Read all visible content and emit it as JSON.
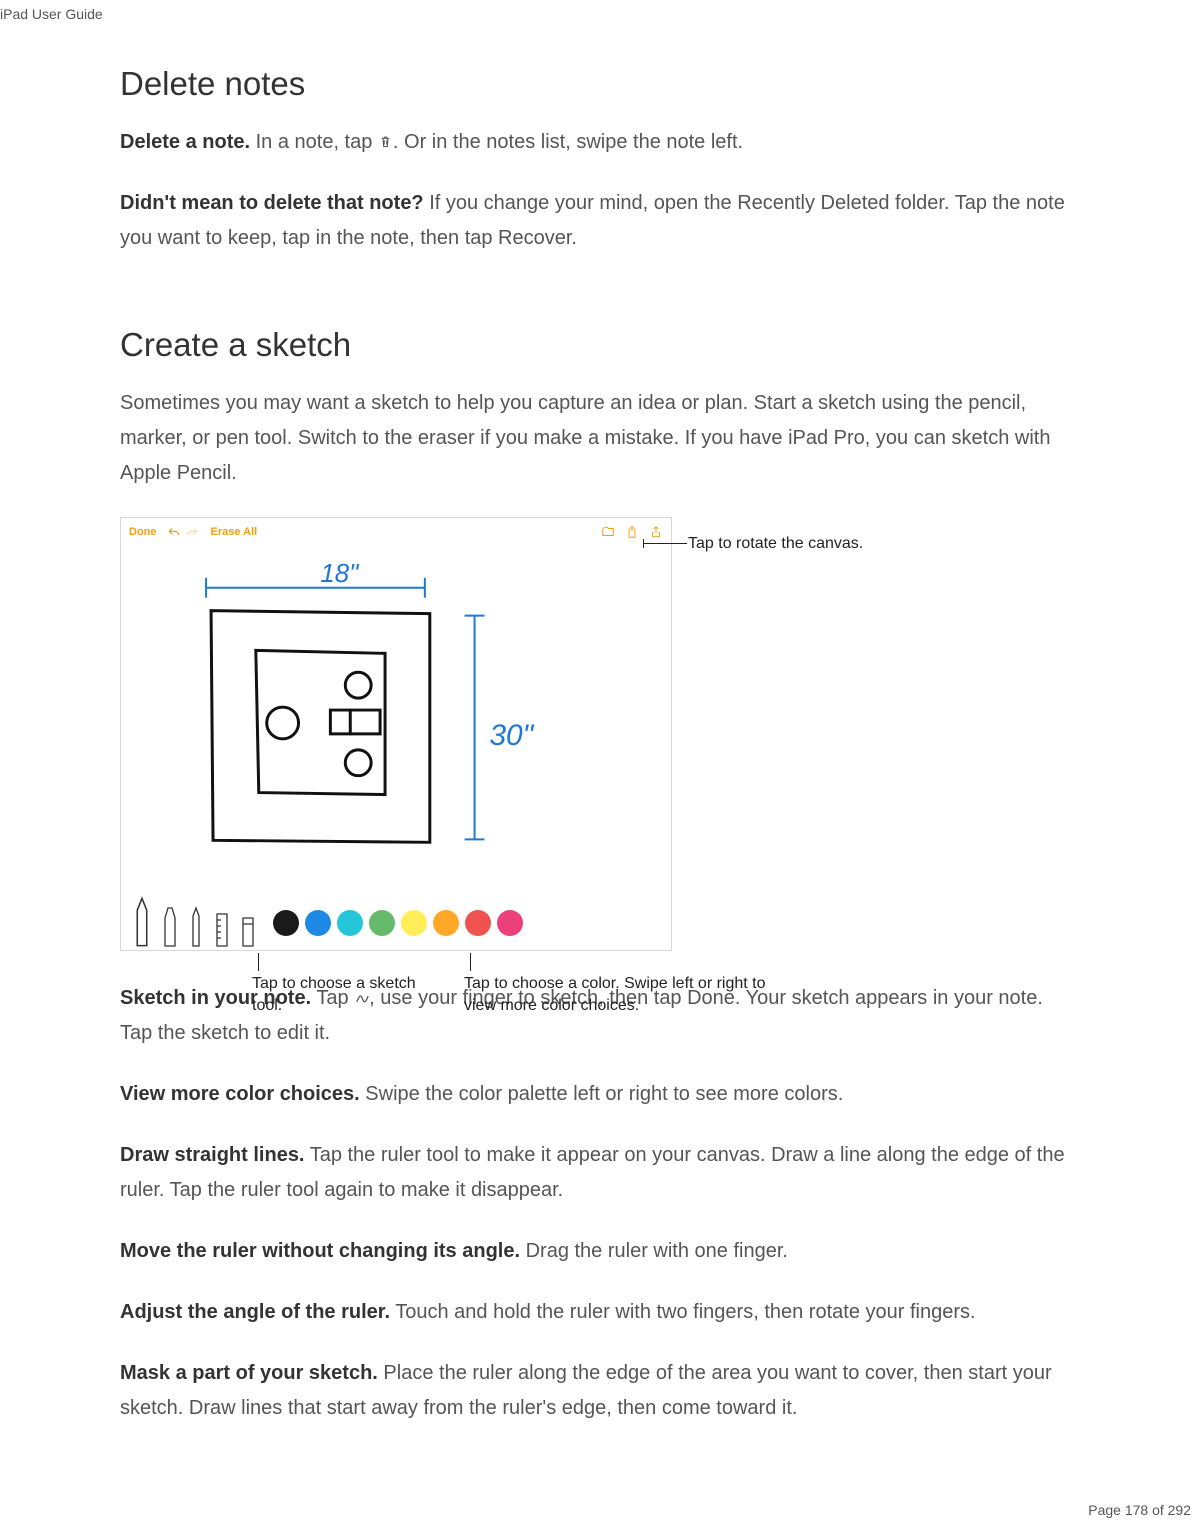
{
  "header": {
    "doc_title": "iPad User Guide"
  },
  "footer": {
    "page_info": "Page 178 of 292"
  },
  "section1": {
    "heading": "Delete notes",
    "p1_strong": "Delete a note.",
    "p1a": " In a note, tap ",
    "p1b": ". Or in the notes list, swipe the note left.",
    "p2_strong": "Didn't mean to delete that note?",
    "p2": " If you change your mind, open the Recently Deleted folder. Tap the note you want to keep, tap in the note, then tap Recover."
  },
  "section2": {
    "heading": "Create a sketch",
    "intro": "Sometimes you may want a sketch to help you capture an idea or plan. Start a sketch using the pencil, marker, or pen tool. Switch to the eraser if you make a mistake. If you have iPad Pro, you can sketch with Apple Pencil.",
    "p1_strong": "Sketch in your note.",
    "p1a": " Tap ",
    "p1b": ", use your finger to sketch, then tap Done. Your sketch appears in your note. Tap the sketch to edit it.",
    "p2_strong": "View more color choices.",
    "p2": " Swipe the color palette left or right to see more colors.",
    "p3_strong": "Draw straight lines.",
    "p3": " Tap the ruler tool to make it appear on your canvas. Draw a line along the edge of the ruler. Tap the ruler tool again to make it disappear.",
    "p4_strong": "Move the ruler without changing its angle.",
    "p4": " Drag the ruler with one finger.",
    "p5_strong": "Adjust the angle of the ruler.",
    "p5": " Touch and hold the ruler with two fingers, then rotate your fingers.",
    "p6_strong": "Mask a part of your sketch.",
    "p6": " Place the ruler along the edge of the area you want to cover, then start your sketch. Draw lines that start away from the ruler's edge, then come toward it."
  },
  "figure": {
    "topbar": {
      "done": "Done",
      "erase": "Erase All"
    },
    "sketch_labels": {
      "width": "18\"",
      "height": "30\""
    },
    "callouts": {
      "rotate": "Tap to rotate the canvas.",
      "tool": "Tap to choose a sketch tool.",
      "color": "Tap to choose a color. Swipe left or right to view more color choices."
    }
  }
}
